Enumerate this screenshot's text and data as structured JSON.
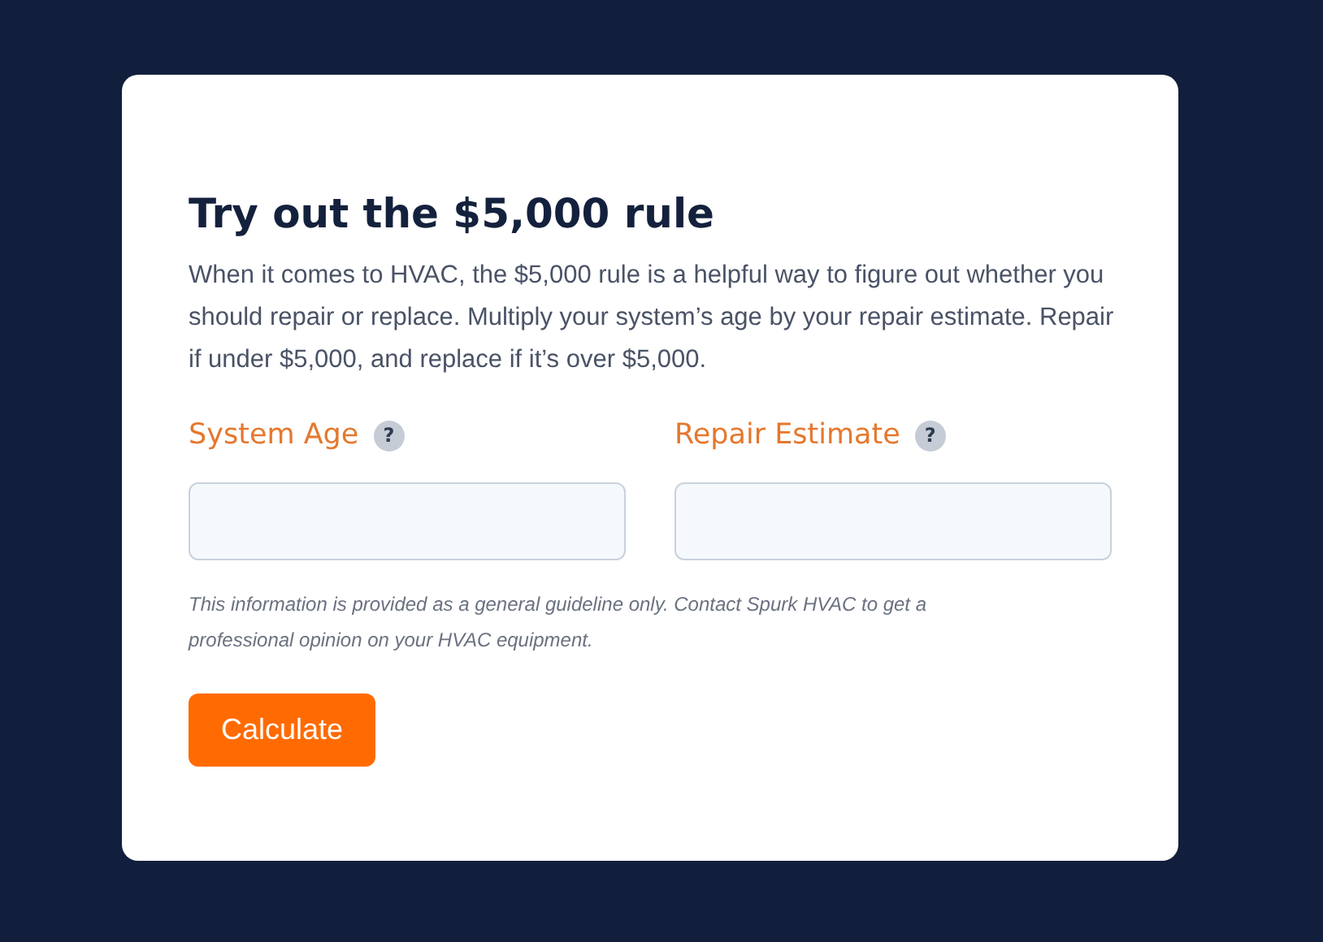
{
  "card": {
    "title": "Try out the $5,000 rule",
    "description": "When it comes to HVAC, the $5,000 rule is a helpful way to figure out whether you should repair or replace. Multiply your system’s age by your repair estimate. Repair if under $5,000, and replace if it’s over $5,000.",
    "fields": [
      {
        "label": "System Age",
        "help": "?"
      },
      {
        "label": "Repair Estimate",
        "help": "?"
      }
    ],
    "disclaimer": "This information is provided as a general guideline only. Contact Spurk HVAC to get a professional opinion on your HVAC equipment.",
    "button": "Calculate"
  }
}
